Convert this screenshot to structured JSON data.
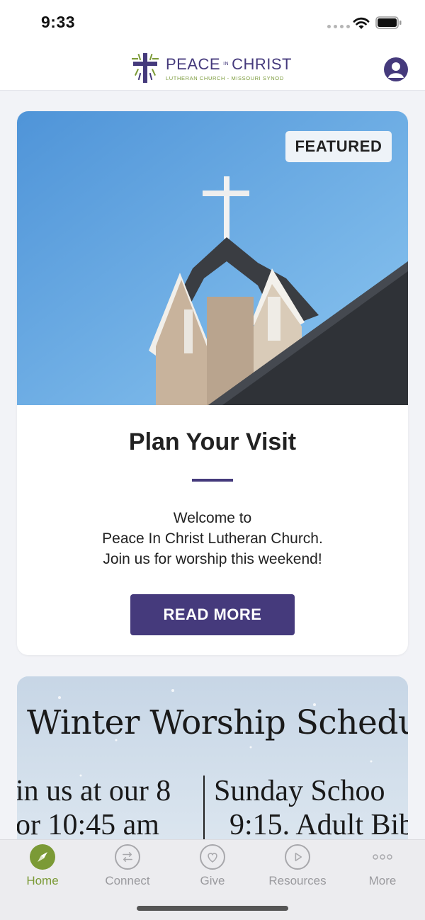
{
  "status_bar": {
    "time": "9:33"
  },
  "header": {
    "logo_line1_a": "PEACE",
    "logo_line1_in": "IN",
    "logo_line1_b": "CHRIST",
    "logo_line2": "LUTHERAN CHURCH - MISSOURI SYNOD"
  },
  "featured_card": {
    "badge": "FEATURED",
    "title": "Plan Your Visit",
    "body_lines": [
      "Welcome to",
      "Peace In Christ Lutheran Church.",
      "Join us for worship this weekend!"
    ],
    "button_label": "READ MORE"
  },
  "schedule_card": {
    "title": "Winter Worship Schedule",
    "left_line1": "in us at our 8",
    "left_line2": "or 10:45 am",
    "right_line1": "Sunday Schoo",
    "right_line2": "9:15. Adult Bib"
  },
  "tab_bar": {
    "tabs": [
      {
        "label": "Home",
        "icon": "compass-icon",
        "active": true
      },
      {
        "label": "Connect",
        "icon": "arrows-exchange-icon",
        "active": false
      },
      {
        "label": "Give",
        "icon": "heart-icon",
        "active": false
      },
      {
        "label": "Resources",
        "icon": "play-icon",
        "active": false
      },
      {
        "label": "More",
        "icon": "more-dots-icon",
        "active": false
      }
    ]
  },
  "colors": {
    "brand_purple": "#453a7c",
    "brand_green": "#7b9a36",
    "background": "#f2f3f7"
  }
}
